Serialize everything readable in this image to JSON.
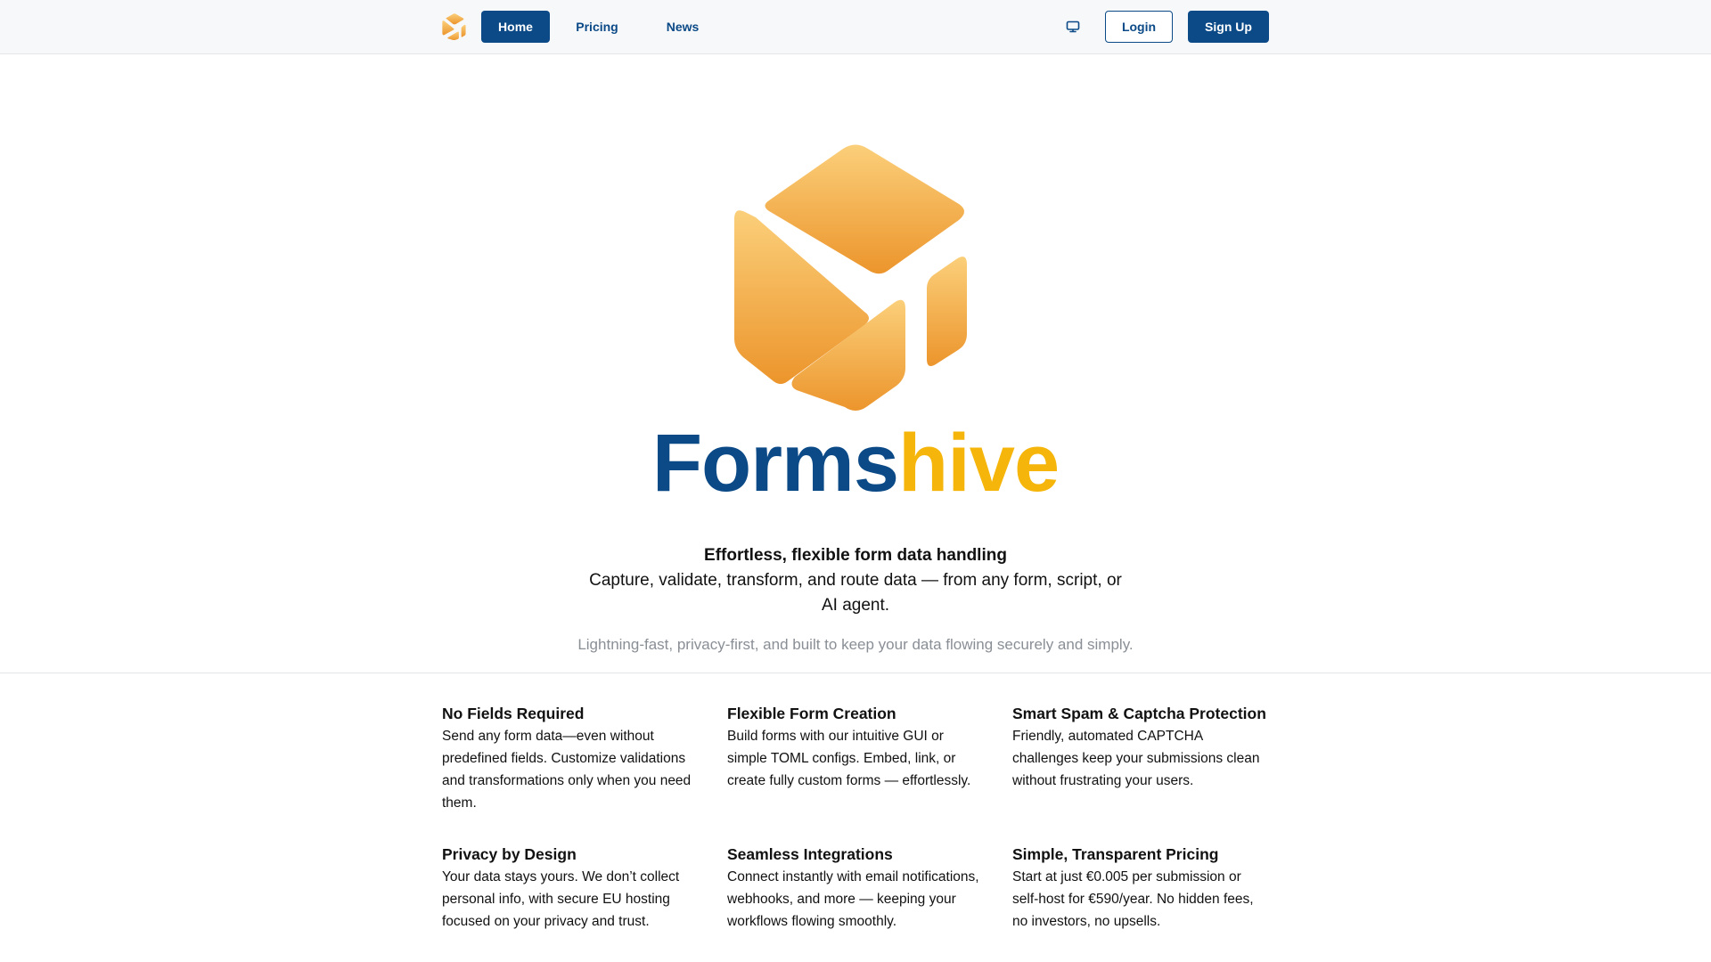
{
  "nav": {
    "logo_icon": "hive-cube-icon",
    "items": [
      {
        "label": "Home",
        "active": true
      },
      {
        "label": "Pricing",
        "active": false
      },
      {
        "label": "News",
        "active": false
      }
    ],
    "theme_icon": "monitor-icon",
    "login_label": "Login",
    "signup_label": "Sign Up"
  },
  "hero": {
    "logo_icon": "hive-cube-icon",
    "brand_part1": "Forms",
    "brand_part2": "hive",
    "tagline_title": "Effortless, flexible form data handling",
    "tagline_body": "Capture, validate, transform, and route data — from any form, script, or AI agent.",
    "tagline_muted": "Lightning-fast, privacy-first, and built to keep your data flowing securely and simply."
  },
  "features": [
    {
      "title": "No Fields Required",
      "text": "Send any form data—even without predefined fields. Customize validations and transformations only when you need them."
    },
    {
      "title": "Flexible Form Creation",
      "text": "Build forms with our intuitive GUI or simple TOML configs. Embed, link, or create fully custom forms — effortlessly."
    },
    {
      "title": "Smart Spam & Captcha Protection",
      "text": "Friendly, automated CAPTCHA challenges keep your submissions clean without frustrating your users."
    },
    {
      "title": "Privacy by Design",
      "text": "Your data stays yours. We don’t collect personal info, with secure EU hosting focused on your privacy and trust."
    },
    {
      "title": "Seamless Integrations",
      "text": "Connect instantly with email notifications, webhooks, and more — keeping your workflows flowing smoothly."
    },
    {
      "title": "Simple, Transparent Pricing",
      "text": "Start at just €0.005 per submission or self-host for €590/year. No hidden fees, no investors, no upsells."
    }
  ],
  "colors": {
    "primary": "#0b4a87",
    "accent": "#f5b50a",
    "logo_gradient_top": "#fbcf7a",
    "logo_gradient_bottom": "#ec952c",
    "muted_text": "#8a8f96"
  }
}
